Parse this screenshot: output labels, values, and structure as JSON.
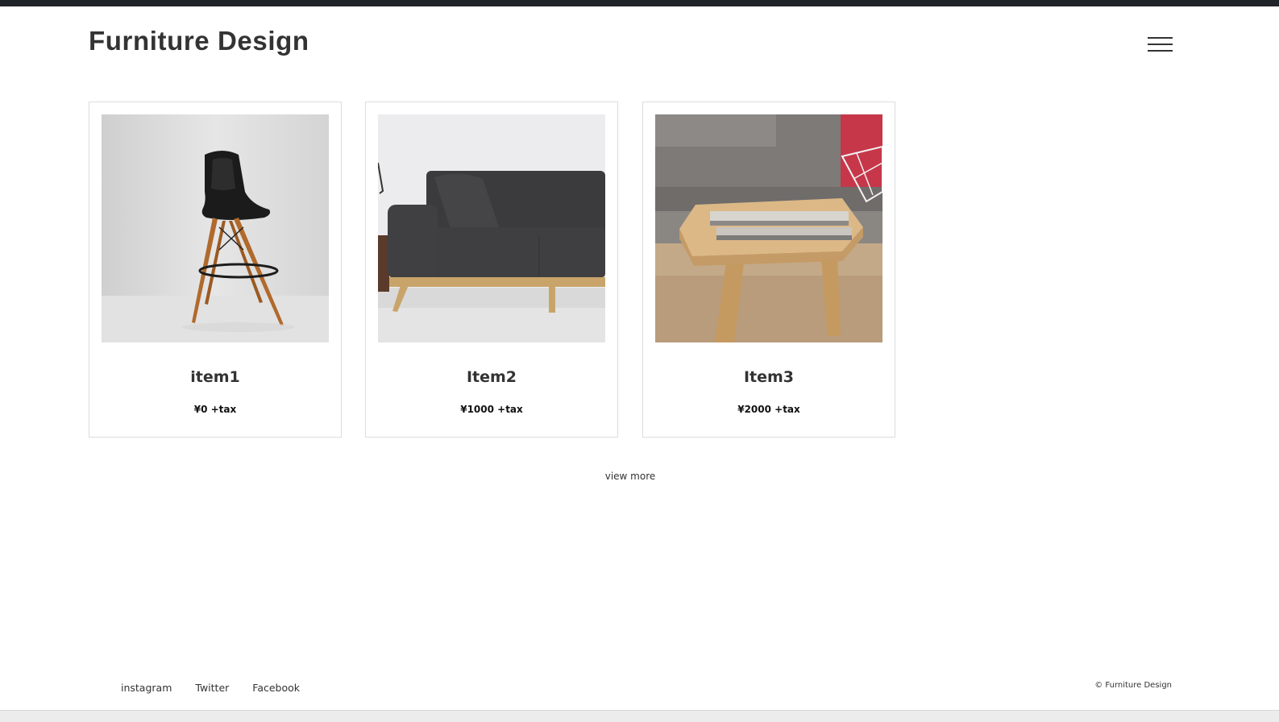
{
  "header": {
    "title": "Furniture Design",
    "menu_icon": "hamburger-menu-icon"
  },
  "products": [
    {
      "name": "item1",
      "price": "¥0 +tax",
      "image": "black-bar-stool-photo"
    },
    {
      "name": "Item2",
      "price": "¥1000 +tax",
      "image": "grey-sofa-photo"
    },
    {
      "name": "Item3",
      "price": "¥2000 +tax",
      "image": "wooden-coffee-table-photo"
    }
  ],
  "view_more": "view more",
  "footer": {
    "links": [
      "instagram",
      "Twitter",
      "Facebook"
    ],
    "copyright": "© Furniture Design"
  }
}
